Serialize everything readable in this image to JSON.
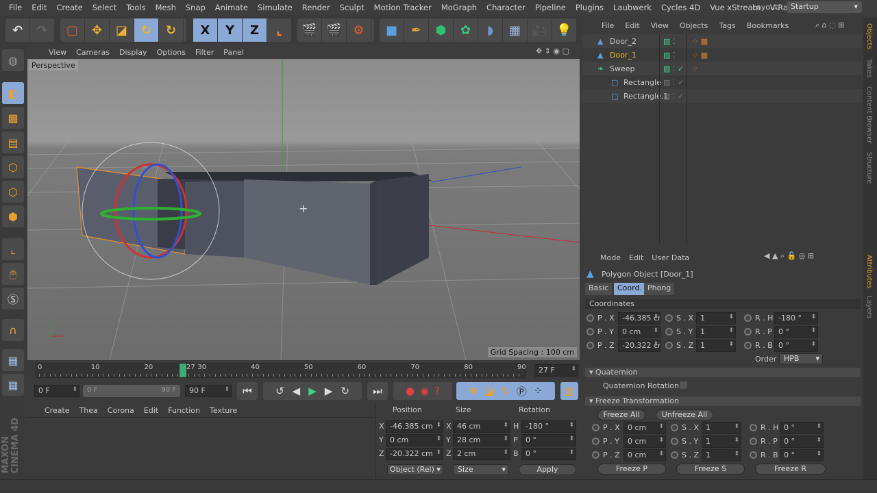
{
  "menubar": {
    "items": [
      "File",
      "Edit",
      "Create",
      "Select",
      "Tools",
      "Mesh",
      "Snap",
      "Animate",
      "Simulate",
      "Render",
      "Sculpt",
      "Motion Tracker",
      "MoGraph",
      "Character",
      "Pipeline",
      "Plugins",
      "Laubwerk",
      "Cycles 4D",
      "Vue xStream",
      "V-Ray"
    ],
    "layout_label": "Layout:",
    "layout_value": "Startup"
  },
  "toolbar": {
    "axis": [
      "X",
      "Y",
      "Z"
    ]
  },
  "viewport": {
    "menu": [
      "View",
      "Cameras",
      "Display",
      "Options",
      "Filter",
      "Panel"
    ],
    "camera": "Perspective",
    "grid_spacing": "Grid Spacing : 100 cm"
  },
  "timeline": {
    "ticks": [
      "0",
      "10",
      "20",
      "30",
      "40",
      "50",
      "60",
      "70",
      "80",
      "90"
    ],
    "current_frame_label": "27",
    "current_frame": "27 F",
    "start": "0 F",
    "range_start": "0 F",
    "range_end": "90 F",
    "end": "90 F",
    "current": 27,
    "max": 90
  },
  "material_menu": [
    "Create",
    "Thea",
    "Corona",
    "Edit",
    "Function",
    "Texture"
  ],
  "coord_manager": {
    "headers": [
      "Position",
      "Size",
      "Rotation"
    ],
    "rows": [
      {
        "pl": "X",
        "p": "-46.385 cm",
        "sl": "X",
        "s": "46 cm",
        "rl": "H",
        "r": "-180 °"
      },
      {
        "pl": "Y",
        "p": "0 cm",
        "sl": "Y",
        "s": "28 cm",
        "rl": "P",
        "r": "0 °"
      },
      {
        "pl": "Z",
        "p": "-20.322 cm",
        "sl": "Z",
        "s": "2 cm",
        "rl": "B",
        "r": "0 °"
      }
    ],
    "mode": "Object (Rel)",
    "size_mode": "Size",
    "apply": "Apply"
  },
  "object_manager": {
    "menu": [
      "File",
      "Edit",
      "View",
      "Objects",
      "Tags",
      "Bookmarks"
    ],
    "objects": [
      {
        "name": "Door_2",
        "icon": "polygon-icon",
        "selected": false
      },
      {
        "name": "Door_1",
        "icon": "polygon-icon",
        "selected": true
      },
      {
        "name": "Sweep",
        "icon": "sweep-icon",
        "selected": false
      },
      {
        "name": "Rectangle",
        "icon": "spline-rectangle-icon",
        "selected": false
      },
      {
        "name": "Rectangle.1",
        "icon": "spline-rectangle-icon",
        "selected": false
      }
    ]
  },
  "attributes": {
    "menu": [
      "Mode",
      "Edit",
      "User Data"
    ],
    "title": "Polygon Object [Door_1]",
    "tabs": [
      "Basic",
      "Coord.",
      "Phong"
    ],
    "active_tab": "Coord.",
    "coordinates_title": "Coordinates",
    "coords": [
      {
        "pl": "P . X",
        "p": "-46.385 cr",
        "sl": "S . X",
        "s": "1",
        "rl": "R . H",
        "r": "-180 °"
      },
      {
        "pl": "P . Y",
        "p": "0 cm",
        "sl": "S . Y",
        "s": "1",
        "rl": "R . P",
        "r": "0 °"
      },
      {
        "pl": "P . Z",
        "p": "-20.322 cr",
        "sl": "S . Z",
        "s": "1",
        "rl": "R . B",
        "r": "0 °"
      }
    ],
    "order_label": "Order",
    "order_value": "HPB",
    "quaternion_title": "Quaternion",
    "quaternion_rotation": "Quaternion Rotation",
    "freeze_title": "Freeze Transformation",
    "freeze_all": "Freeze All",
    "unfreeze_all": "Unfreeze All",
    "freeze": [
      {
        "pl": "P . X",
        "p": "0 cm",
        "sl": "S . X",
        "s": "1",
        "rl": "R . H",
        "r": "0 °"
      },
      {
        "pl": "P . Y",
        "p": "0 cm",
        "sl": "S . Y",
        "s": "1",
        "rl": "R . P",
        "r": "0 °"
      },
      {
        "pl": "P . Z",
        "p": "0 cm",
        "sl": "S . Z",
        "s": "1",
        "rl": "R . B",
        "r": "0 °"
      }
    ],
    "freeze_p": "Freeze P",
    "freeze_s": "Freeze S",
    "freeze_r": "Freeze R"
  },
  "side_tabs": [
    "Objects",
    "Takes",
    "Content Browser",
    "Structure"
  ],
  "side_tabs_lower": [
    "Attributes",
    "Layers"
  ],
  "logo": "MAXON CINEMA 4D",
  "colors": {
    "accent": "#8aa9d6",
    "selected": "#f0b429",
    "orange": "#e8a030"
  }
}
